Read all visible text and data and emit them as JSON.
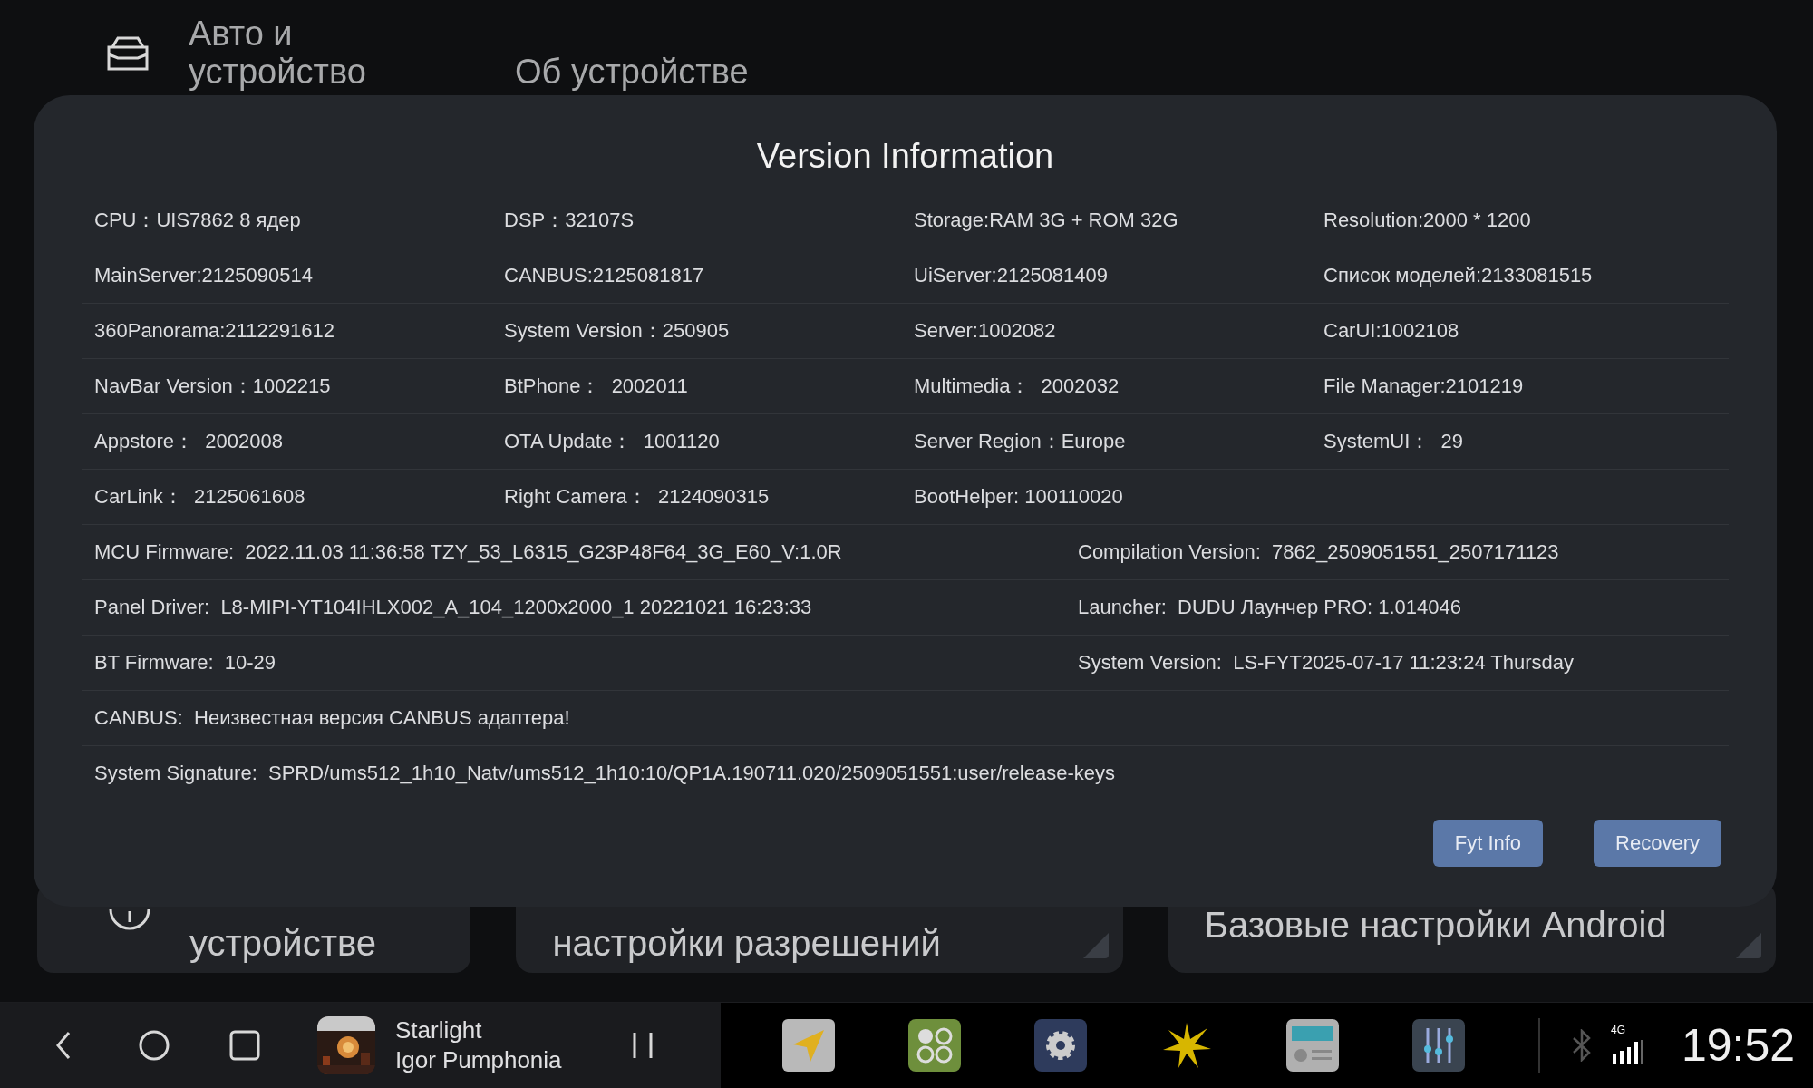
{
  "background": {
    "nav_title_lines": [
      "Авто и",
      "устройство"
    ],
    "section_title": "Об устройстве",
    "cards": [
      {
        "kind": "info",
        "text": "устройстве"
      },
      {
        "kind": "corner",
        "text": "настройки разрешений"
      },
      {
        "kind": "corner",
        "text": "Базовые настройки Android"
      }
    ]
  },
  "dialog": {
    "title": "Version Information",
    "rows": [
      {
        "kind": "quad",
        "cells": [
          "CPU：UIS7862 8 ядер",
          "DSP：32107S",
          "Storage:RAM 3G + ROM 32G",
          "Resolution:2000 * 1200"
        ]
      },
      {
        "kind": "quad",
        "cells": [
          "MainServer:2125090514",
          "CANBUS:2125081817",
          "UiServer:2125081409",
          "Список моделей:2133081515"
        ]
      },
      {
        "kind": "quad",
        "cells": [
          "360Panorama:2112291612",
          "System Version：250905",
          "Server:1002082",
          "CarUI:1002108"
        ]
      },
      {
        "kind": "quad",
        "cells": [
          "NavBar Version：1002215",
          "BtPhone：  2002011",
          "Multimedia：  2002032",
          "File Manager:2101219"
        ]
      },
      {
        "kind": "quad",
        "cells": [
          "Appstore：  2002008",
          "OTA Update：  1001120",
          "Server Region：Europe",
          "SystemUI：  29"
        ]
      },
      {
        "kind": "quad",
        "cells": [
          "CarLink：  2125061608",
          "Right Camera：  2124090315",
          "BootHelper: 100110020"
        ]
      },
      {
        "kind": "pair",
        "cells": [
          "MCU Firmware:  2022.11.03 11:36:58 TZY_53_L6315_G23P48F64_3G_E60_V:1.0R",
          "Compilation Version:  7862_2509051551_2507171123"
        ]
      },
      {
        "kind": "pair",
        "cells": [
          "Panel Driver:  L8-MIPI-YT104IHLX002_A_104_1200x2000_1 20221021 16:23:33",
          "Launcher:  DUDU Лаунчер PRO: 1.014046"
        ]
      },
      {
        "kind": "pair",
        "cells": [
          "BT Firmware:  10-29",
          "System Version:  LS-FYT2025-07-17 11:23:24 Thursday"
        ]
      },
      {
        "kind": "single",
        "cells": [
          "CANBUS:  Неизвестная версия CANBUS адаптера!"
        ]
      },
      {
        "kind": "single",
        "cells": [
          "System Signature:  SPRD/ums512_1h10_Natv/ums512_1h10:10/QP1A.190711.020/2509051551:user/release-keys"
        ]
      }
    ],
    "buttons": [
      "Fyt Info",
      "Recovery"
    ]
  },
  "taskbar": {
    "media": {
      "title": "Starlight",
      "artist": "Igor Pumphonia"
    },
    "apps": [
      {
        "kind": "navigator"
      },
      {
        "kind": "apps"
      },
      {
        "kind": "settings"
      },
      {
        "kind": "burst"
      },
      {
        "kind": "radio"
      },
      {
        "kind": "equalizer"
      }
    ],
    "network": "4G",
    "time": "19:52"
  }
}
